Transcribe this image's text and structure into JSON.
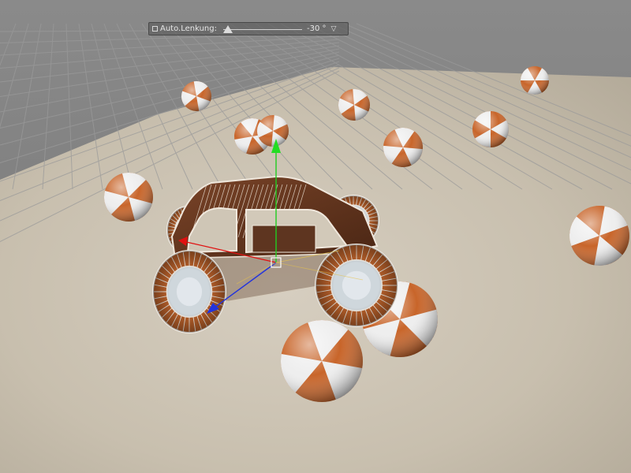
{
  "hud": {
    "checkbox_checked": false,
    "label": "Auto.Lenkung:",
    "value": "-30 °",
    "slider_fraction": 0.0,
    "dropdown_icon": "triangle-down-icon"
  },
  "scene": {
    "floor_color": "#cfc6b6",
    "grid_color": "#8a8a8a",
    "ball_colors": [
      "#c8652a",
      "#eeeeee"
    ],
    "car_body_color": "#6b3a22",
    "axis_colors": {
      "x": "#e01010",
      "y": "#22cc22",
      "z": "#2233dd"
    }
  }
}
